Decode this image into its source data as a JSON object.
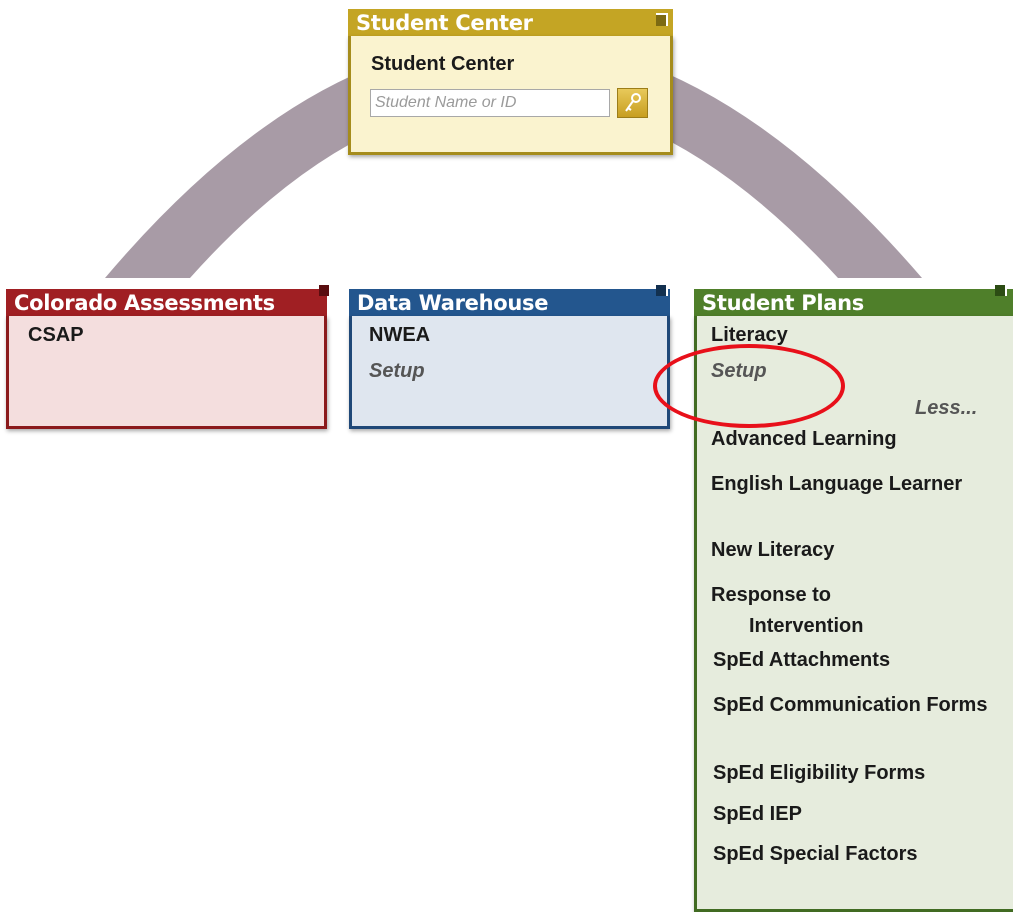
{
  "student_center": {
    "header": "Student Center",
    "title": "Student Center",
    "search_placeholder": "Student Name or ID",
    "search_icon": "key-search-icon"
  },
  "colorado_assessments": {
    "header": "Colorado Assessments",
    "items": [
      "CSAP"
    ]
  },
  "data_warehouse": {
    "header": "Data Warehouse",
    "items": [
      "NWEA"
    ],
    "setup": "Setup"
  },
  "student_plans": {
    "header": "Student Plans",
    "first_item": "Literacy",
    "setup": "Setup",
    "less_link": "Less...",
    "items": [
      "Advanced Learning",
      "English Language Learner",
      "New Literacy",
      "Response to Intervention",
      "SpEd Attachments",
      "SpEd Communication Forms",
      "SpEd Eligibility Forms",
      "SpEd IEP",
      "SpEd Special Factors"
    ]
  },
  "colors": {
    "student_center": "#c4a524",
    "colorado_assessments": "#a01f23",
    "data_warehouse": "#23568e",
    "student_plans": "#4f7f2a",
    "arc": "#a89ba6",
    "highlight": "#e8101a"
  }
}
